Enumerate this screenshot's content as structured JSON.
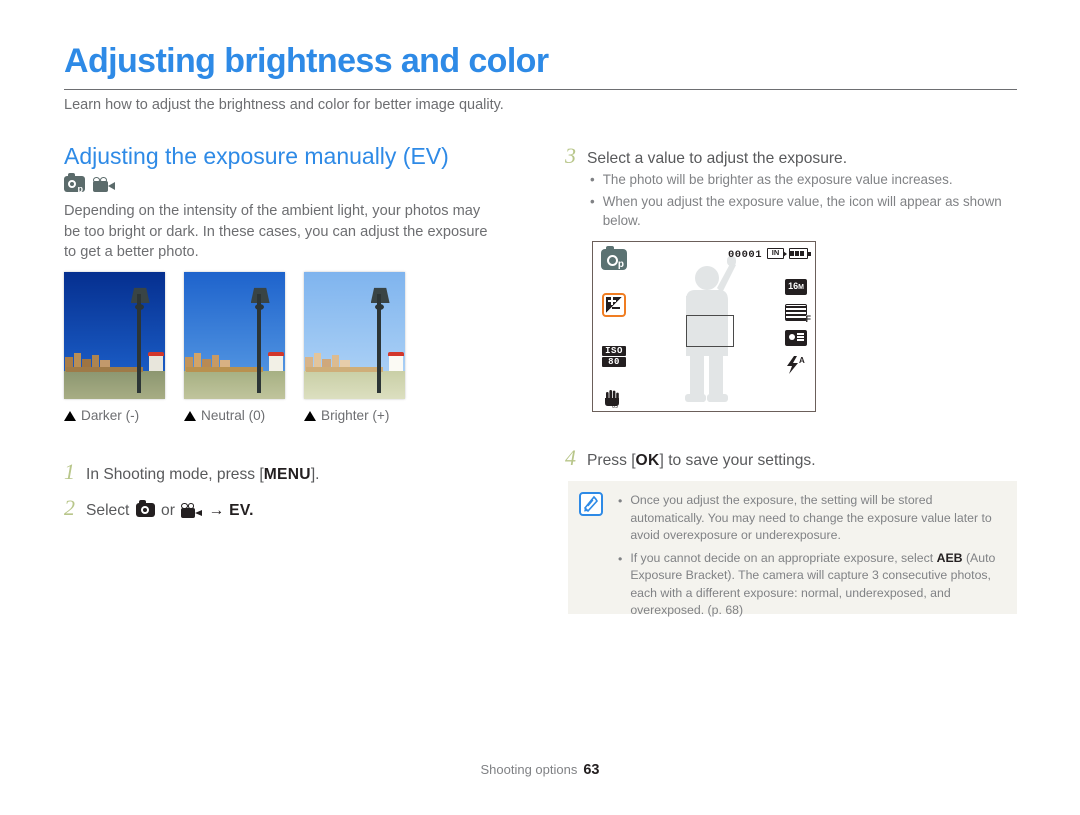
{
  "header": {
    "title": "Adjusting brightness and color",
    "subtitle": "Learn how to adjust the brightness and color for better image quality.",
    "title_color": "#2e8ae6"
  },
  "section": {
    "heading": "Adjusting the exposure manually (EV)",
    "mode_icons": [
      "camera-program-icon",
      "camcorder-icon"
    ],
    "lead_paragraph": "Depending on the intensity of the ambient light, your photos may be too bright or dark. In these cases, you can adjust the exposure to get a better photo."
  },
  "photo_examples": [
    {
      "caption": "Darker (-)",
      "sky_color": "#0b3fa8",
      "water_color": "#9aa37a",
      "variant": "dark"
    },
    {
      "caption": "Neutral (0)",
      "sky_color": "#2b72d4",
      "water_color": "#b7bd92",
      "variant": "neutral"
    },
    {
      "caption": "Brighter (+)",
      "sky_color": "#89bcf0",
      "water_color": "#d2d5ae",
      "variant": "bright"
    }
  ],
  "steps": [
    {
      "number": "1",
      "text_before": "In Shooting mode, press [",
      "key": "MENU",
      "text_after": "]."
    },
    {
      "number": "2",
      "text_before": "Select",
      "text_middle": "or",
      "text_after": "→ EV."
    },
    {
      "number": "3",
      "text": "Select a value to adjust the exposure."
    },
    {
      "number": "4",
      "text_before": "Press [",
      "key": "OK",
      "text_after": "] to save your settings."
    }
  ],
  "step3_bullets": [
    "The photo will be brighter as the exposure value increases.",
    "When you adjust the exposure value, the icon will appear as shown below."
  ],
  "lcd_screen": {
    "counter": "00001",
    "memory_label": "IN",
    "battery": "battery-full-icon",
    "mode_badge": "p",
    "resolution_label": "16",
    "resolution_suffix": "M",
    "quality_label": "F",
    "iso_top": "ISO",
    "iso_bottom": "80",
    "flash_label": "A",
    "ev_highlight_color": "#f07d22",
    "left_icons": [
      "program-mode-icon",
      "exposure-value-icon",
      "iso-icon",
      "anti-shake-icon"
    ],
    "right_icons": [
      "resolution-icon",
      "quality-icon",
      "burst-icon",
      "flash-auto-icon"
    ]
  },
  "note_box": {
    "icon": "note-pen-icon",
    "bullets": [
      {
        "text": "Once you adjust the exposure, the setting will be stored automatically. You may need to change the exposure value later to avoid overexposure or underexposure."
      },
      {
        "prefix": "If you cannot decide on an appropriate exposure, select ",
        "bold": "AEB",
        "suffix": " (Auto Exposure Bracket). The camera will capture 3 consecutive photos, each with a different exposure: normal, underexposed, and overexposed. (p. 68)"
      }
    ]
  },
  "footer": {
    "label": "Shooting options",
    "page_number": "63"
  }
}
